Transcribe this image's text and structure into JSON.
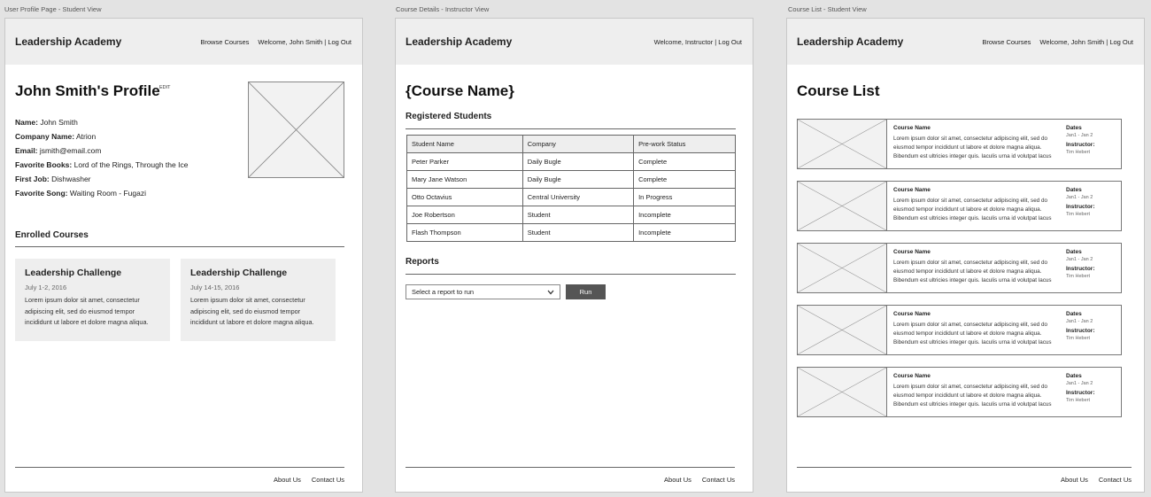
{
  "boards": [
    {
      "title": "User Profile Page - Student  View"
    },
    {
      "title": "Course Details - Instructor View"
    },
    {
      "title": "Course List - Student View"
    }
  ],
  "brand": "Leadership Academy",
  "profile": {
    "nav": {
      "browse": "Browse Courses",
      "welcome": "Welcome, John Smith | Log Out"
    },
    "title": "John Smith's Profile",
    "edit": "EDIT",
    "fields": [
      {
        "label": "Name:",
        "value": " John Smith"
      },
      {
        "label": "Company Name:",
        "value": " Atrion"
      },
      {
        "label": "Email:",
        "value": " jsmith@email.com"
      },
      {
        "label": "Favorite Books:",
        "value": " Lord of the Rings, Through the Ice"
      },
      {
        "label": "First Job:",
        "value": " Dishwasher"
      },
      {
        "label": "Favorite Song:",
        "value": " Waiting Room - Fugazi"
      }
    ],
    "enrolled_heading": "Enrolled Courses",
    "courses": [
      {
        "title": "Leadership Challenge",
        "date": "July 1-2, 2016",
        "text": "Lorem ipsum dolor sit amet, consectetur adipiscing elit, sed do eiusmod tempor incididunt ut labore et dolore magna aliqua."
      },
      {
        "title": "Leadership Challenge",
        "date": "July 14-15, 2016",
        "text": "Lorem ipsum dolor sit amet, consectetur adipiscing elit, sed do eiusmod tempor incididunt ut labore et dolore magna aliqua."
      }
    ]
  },
  "details": {
    "nav": {
      "welcome": "Welcome, Instructor | Log Out"
    },
    "title": "{Course Name}",
    "registered_heading": "Registered Students",
    "columns": [
      "Student Name",
      "Company",
      "Pre-work Status"
    ],
    "rows": [
      [
        "Peter Parker",
        "Daily Bugle",
        "Complete"
      ],
      [
        "Mary Jane Watson",
        "Daily Bugle",
        "Complete"
      ],
      [
        "Otto Octavius",
        "Central University",
        "In Progress"
      ],
      [
        "Joe Robertson",
        "Student",
        "Incomplete"
      ],
      [
        "Flash Thompson",
        "Student",
        "Incomplete"
      ]
    ],
    "reports_heading": "Reports",
    "select_value": "Select a report to run",
    "run_label": "Run"
  },
  "list": {
    "nav": {
      "browse": "Browse Courses",
      "welcome": "Welcome, John Smith | Log Out"
    },
    "title": "Course List",
    "item": {
      "name": "Course Name",
      "text": "Lorem ipsum dolor sit amet, consectetur adipiscing elit, sed do eiusmod tempor incididunt ut labore et dolore magna aliqua. Bibendum est ultricies integer quis. Iaculis urna id volutpat lacus",
      "dates_label": "Dates",
      "dates_value": "Jan1 - Jan 2",
      "instructor_label": "Instructor:",
      "instructor_value": "Tim Hebert"
    }
  },
  "footer": {
    "about": "About Us",
    "contact": "Contact Us"
  }
}
